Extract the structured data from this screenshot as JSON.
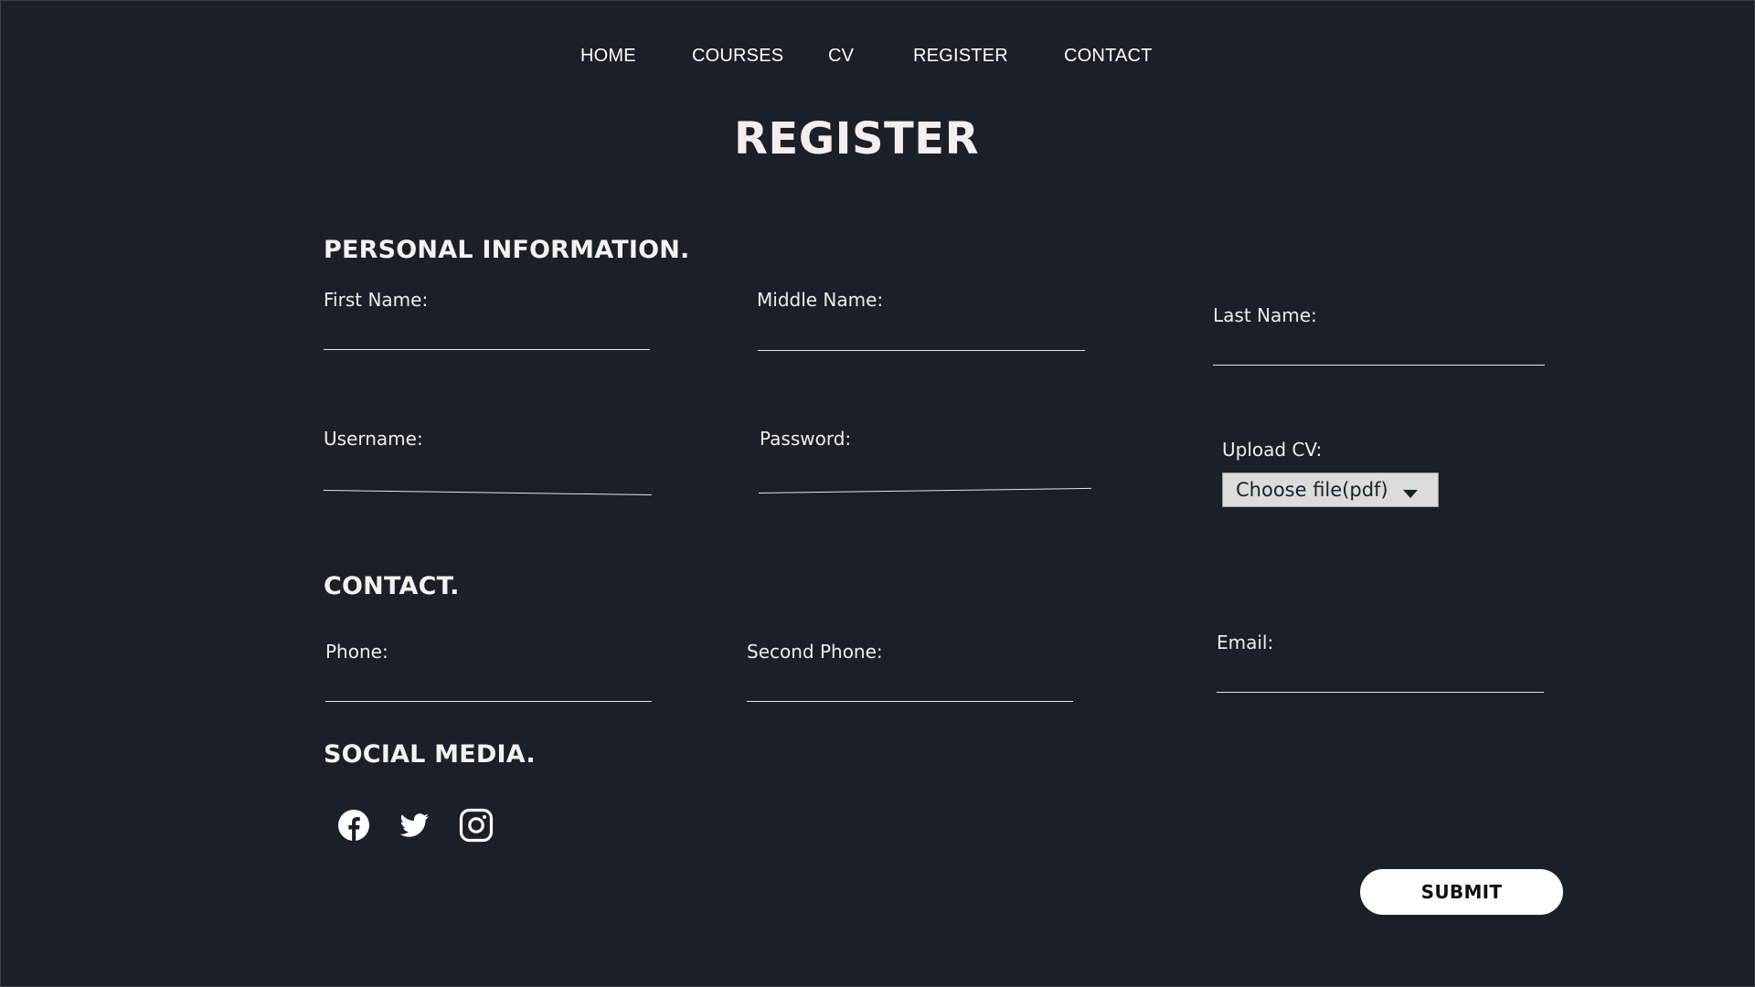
{
  "nav": {
    "items": [
      {
        "label": "HOME"
      },
      {
        "label": "COURSES"
      },
      {
        "label": "CV"
      },
      {
        "label": "REGISTER"
      },
      {
        "label": "CONTACT"
      }
    ]
  },
  "page": {
    "title": "REGISTER"
  },
  "personal": {
    "heading": "PERSONAL INFORMATION.",
    "first_name_label": "First Name:",
    "middle_name_label": "Middle Name:",
    "last_name_label": "Last Name:",
    "username_label": "Username:",
    "password_label": "Password:",
    "upload_label": "Upload CV:",
    "upload_select_value": "Choose file(pdf)"
  },
  "contact": {
    "heading": "CONTACT.",
    "phone_label": "Phone:",
    "second_phone_label": "Second Phone:",
    "email_label": "Email:"
  },
  "social": {
    "heading": "SOCIAL MEDIA.",
    "icons": [
      "facebook-icon",
      "twitter-icon",
      "instagram-icon"
    ]
  },
  "form": {
    "submit_label": "SUBMIT"
  },
  "colors": {
    "background": "#1b1f27",
    "text": "#f2f2f2",
    "button": "#ffffff"
  }
}
